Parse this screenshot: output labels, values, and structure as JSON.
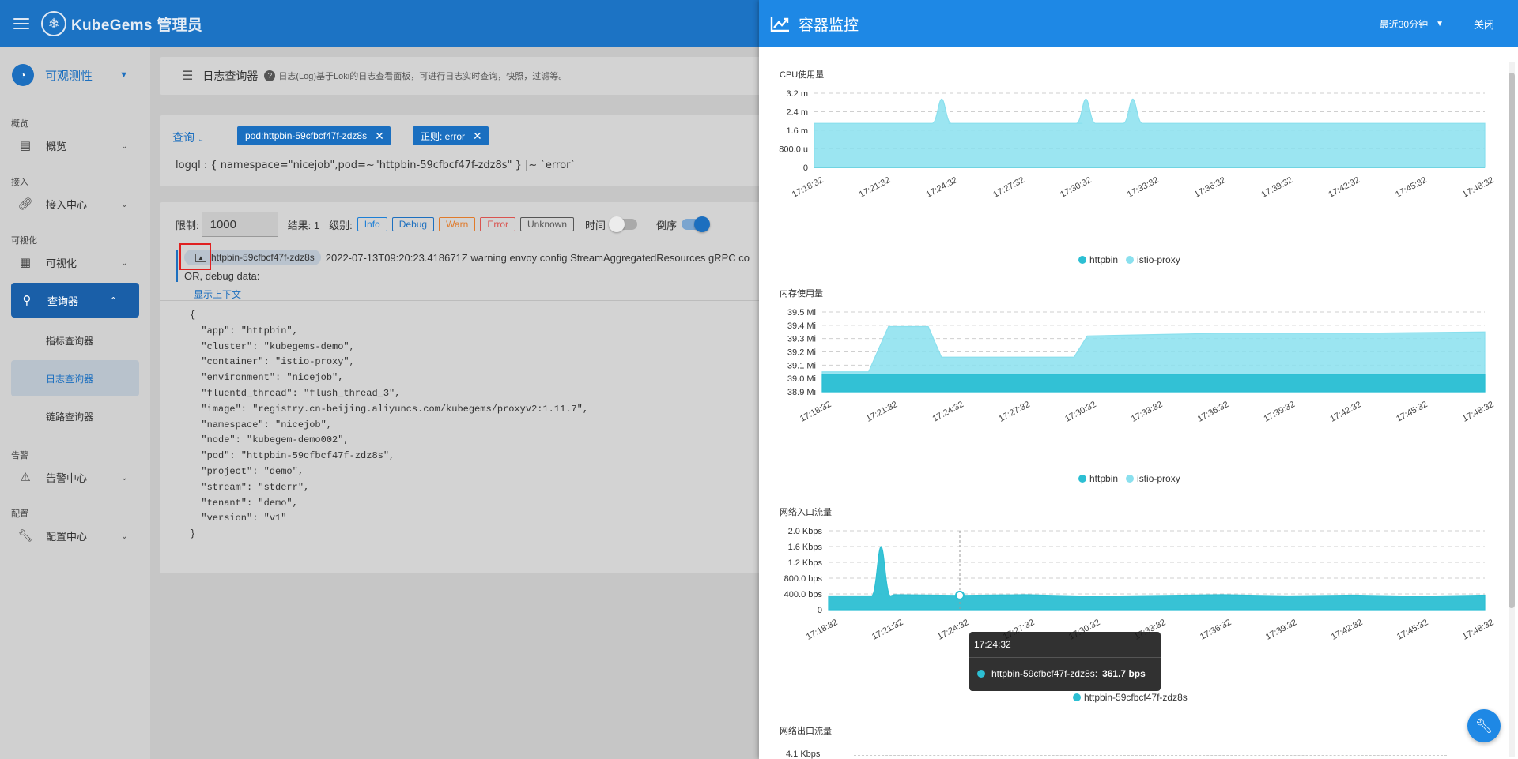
{
  "app": {
    "brand": "KubeGems 管理员"
  },
  "sidebar": {
    "header": "可观测性",
    "sections": [
      {
        "label": "概览",
        "item": "概览"
      },
      {
        "label": "接入",
        "item": "接入中心"
      },
      {
        "label": "可视化",
        "item": "可视化"
      },
      {
        "label": "",
        "item": "查询器"
      }
    ],
    "sub_items": [
      "指标查询器",
      "日志查询器",
      "链路查询器"
    ],
    "alert_section": "告警",
    "alert_item": "告警中心",
    "config_section": "配置",
    "config_item": "配置中心"
  },
  "main": {
    "title": "日志查询器",
    "description": "日志(Log)基于Loki的日志查看面板，可进行日志实时查询，快照，过滤等。",
    "query_button": "查询",
    "chips": [
      "pod:httpbin-59cfbcf47f-zdz8s",
      "正则: error"
    ],
    "logql": "logql : { namespace=\"nicejob\",pod=~\"httpbin-59cfbcf47f-zdz8s\" } |~ `error`",
    "limit_label": "限制:",
    "limit_value": "1000",
    "result_label": "结果: 1",
    "level_label": "级别:",
    "levels": [
      {
        "name": "Info",
        "color": "#1c7fd6"
      },
      {
        "name": "Debug",
        "color": "#1c6fbf"
      },
      {
        "name": "Warn",
        "color": "#e07a2a"
      },
      {
        "name": "Error",
        "color": "#d9534f"
      },
      {
        "name": "Unknown",
        "color": "#555555"
      }
    ],
    "time_label": "时间",
    "reverse_label": "倒序",
    "log_pod": "httpbin-59cfbcf47f-zdz8s",
    "log_text": "2022-07-13T09:20:23.418671Z warning envoy config StreamAggregatedResources gRPC co",
    "log_text2": "OR, debug data:",
    "context_link": "显示上下文",
    "json_text": "{\n  \"app\": \"httpbin\",\n  \"cluster\": \"kubegems-demo\",\n  \"container\": \"istio-proxy\",\n  \"environment\": \"nicejob\",\n  \"fluentd_thread\": \"flush_thread_3\",\n  \"image\": \"registry.cn-beijing.aliyuncs.com/kubegems/proxyv2:1.11.7\",\n  \"namespace\": \"nicejob\",\n  \"node\": \"kubegem-demo002\",\n  \"pod\": \"httpbin-59cfbcf47f-zdz8s\",\n  \"project\": \"demo\",\n  \"stream\": \"stderr\",\n  \"tenant\": \"demo\",\n  \"version\": \"v1\"\n}"
  },
  "panel": {
    "title": "容器监控",
    "range": "最近30分钟",
    "close": "关闭",
    "colors": {
      "httpbin": "#2cbfd3",
      "istio_proxy": "#8ae0ee",
      "header": "#1e88e5"
    },
    "tooltip": {
      "time": "17:24:32",
      "series": "httpbin-59cfbcf47f-zdz8s:",
      "value": "361.7 bps"
    },
    "fourth_title": "网络出口流量",
    "fourth_tick": "4.1 Kbps"
  },
  "chart_data": [
    {
      "type": "area",
      "title": "CPU使用量",
      "x": [
        "17:18:32",
        "17:21:32",
        "17:24:32",
        "17:27:32",
        "17:30:32",
        "17:33:32",
        "17:36:32",
        "17:39:32",
        "17:42:32",
        "17:45:32",
        "17:48:32"
      ],
      "yticks": [
        "0",
        "800.0 u",
        "1.6 m",
        "2.4 m",
        "3.2 m"
      ],
      "ylim": [
        0,
        3.2
      ],
      "series": [
        {
          "name": "httpbin",
          "values": [
            0,
            0,
            0,
            0,
            0,
            0,
            0,
            0,
            0,
            0,
            0
          ]
        },
        {
          "name": "istio-proxy",
          "values": [
            1.9,
            1.9,
            1.9,
            1.9,
            1.9,
            1.9,
            1.9,
            1.9,
            1.9,
            1.9,
            1.9
          ],
          "peaks": [
            {
              "x": 1.9,
              "y": 2.95
            },
            {
              "x": 4.05,
              "y": 2.95
            },
            {
              "x": 4.75,
              "y": 2.95
            }
          ]
        }
      ]
    },
    {
      "type": "area",
      "title": "内存使用量",
      "x": [
        "17:18:32",
        "17:21:32",
        "17:24:32",
        "17:27:32",
        "17:30:32",
        "17:33:32",
        "17:36:32",
        "17:39:32",
        "17:42:32",
        "17:45:32",
        "17:48:32"
      ],
      "yticks": [
        "38.9 Mi",
        "39.0 Mi",
        "39.1 Mi",
        "39.2 Mi",
        "39.3 Mi",
        "39.4 Mi",
        "39.5 Mi"
      ],
      "ylim": [
        38.9,
        39.5
      ],
      "series": [
        {
          "name": "httpbin",
          "values": [
            39.03,
            39.03,
            39.03,
            39.03,
            39.03,
            39.03,
            39.03,
            39.03,
            39.03,
            39.03,
            39.03
          ]
        },
        {
          "name": "istio-proxy",
          "values": [
            39.05,
            39.39,
            39.16,
            39.16,
            39.32,
            39.33,
            39.34,
            39.34,
            39.34,
            39.35,
            39.35
          ]
        }
      ]
    },
    {
      "type": "area",
      "title": "网络入口流量",
      "x": [
        "17:18:32",
        "17:21:32",
        "17:24:32",
        "17:27:32",
        "17:30:32",
        "17:33:32",
        "17:36:32",
        "17:39:32",
        "17:42:32",
        "17:45:32",
        "17:48:32"
      ],
      "yticks": [
        "0",
        "400.0 bps",
        "800.0 bps",
        "1.2 Kbps",
        "1.6 Kbps",
        "2.0 Kbps"
      ],
      "ylim": [
        0,
        2000
      ],
      "series": [
        {
          "name": "httpbin-59cfbcf47f-zdz8s",
          "values": [
            350,
            380,
            362,
            380,
            340,
            360,
            380,
            350,
            370,
            340,
            370
          ],
          "peaks": [
            {
              "x": 0.8,
              "y": 1600
            }
          ]
        }
      ]
    }
  ]
}
